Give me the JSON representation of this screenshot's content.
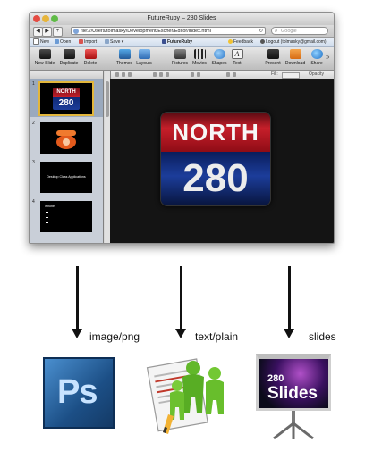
{
  "browser": {
    "window_title": "FutureRuby – 280 Slides",
    "url": "file:///Users/tolmasky/Development/Escher/Editor/index.html",
    "search_placeholder": "Google"
  },
  "menubar": {
    "new": "New",
    "open": "Open",
    "import": "Import",
    "save": "Save ▾",
    "brand": "FutureRuby",
    "feedback": "Feedback",
    "logout": "Logout (tolmasky@gmail.com)"
  },
  "toolbar": {
    "new_slide": "New Slide",
    "duplicate": "Duplicate",
    "delete": "Delete",
    "themes": "Themes",
    "layouts": "Layouts",
    "pictures": "Pictures",
    "movies": "Movies",
    "shapes": "Shapes",
    "text": "Text",
    "present": "Present",
    "download": "Download",
    "share": "Share"
  },
  "formatbar": {
    "fill_label": "Fill:",
    "opacity_label": "Opacity"
  },
  "slides": [
    {
      "number": "1",
      "line1": "NORTH",
      "line2": "280"
    },
    {
      "number": "2"
    },
    {
      "number": "3",
      "text": "Desktop Class Applications"
    },
    {
      "number": "4",
      "text": "iPhone"
    }
  ],
  "main_slide": {
    "line1": "NORTH",
    "line2": "280"
  },
  "outputs": [
    {
      "label": "image/png"
    },
    {
      "label": "text/plain"
    },
    {
      "label": "slides"
    }
  ],
  "icons": {
    "photoshop_text": "Ps",
    "slides_line1": "280",
    "slides_line2": "Slides"
  }
}
